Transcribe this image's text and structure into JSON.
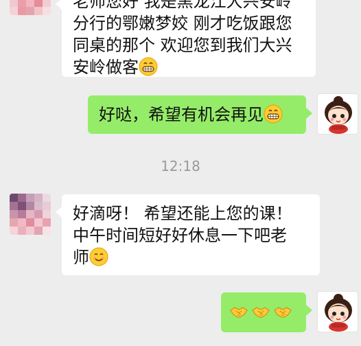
{
  "messages": [
    {
      "sender": "other",
      "lines": [
        "老师您好 我是黑龙江大兴安岭",
        "分行的鄂嫩梦姣 刚才吃饭跟您",
        "同桌的那个 欢迎您到我们大兴",
        "安岭做客"
      ],
      "trailing_emoji": "grinning-face-emoji"
    },
    {
      "sender": "me",
      "text": "好哒，希望有机会再见",
      "trailing_emoji": "grinning-face-emoji"
    },
    {
      "sender": "other",
      "lines": [
        "好滴呀！ 希望还能上您的课！",
        "中午时间短好好休息一下吧老",
        "师"
      ],
      "trailing_emoji": "smiling-face-emoji"
    },
    {
      "sender": "me",
      "emojis": [
        "handshake-emoji",
        "handshake-emoji",
        "handshake-emoji"
      ]
    }
  ],
  "timestamp": "12:18",
  "colors": {
    "background": "#ededed",
    "incoming_bubble": "#ffffff",
    "outgoing_bubble": "#95ec69",
    "timestamp_text": "#9a9a9a"
  }
}
